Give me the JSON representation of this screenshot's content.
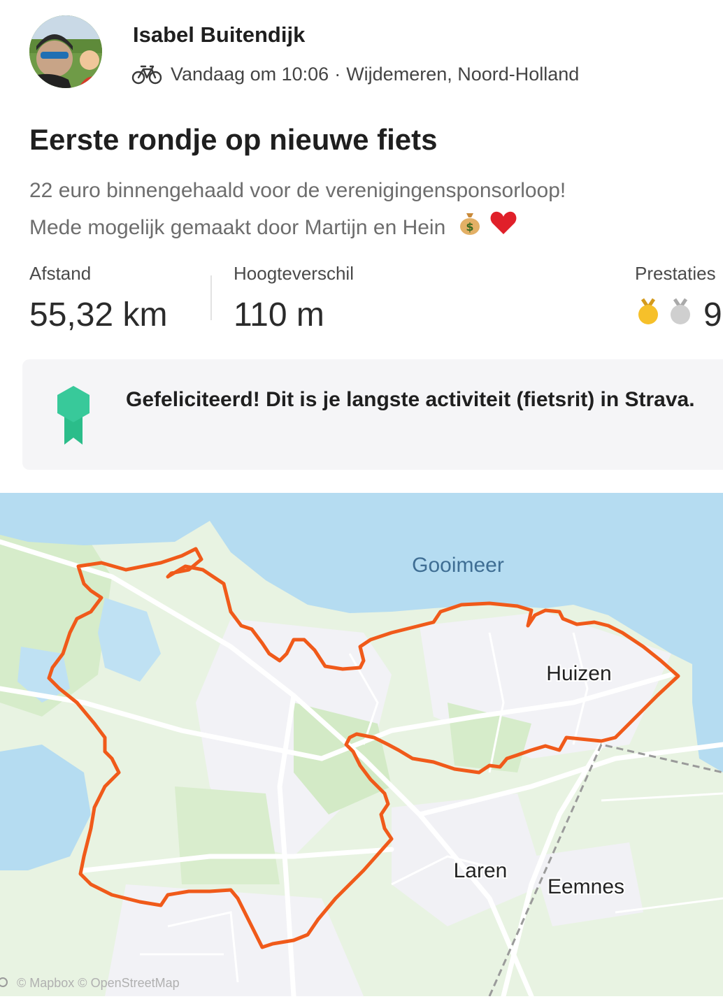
{
  "athlete": {
    "name": "Isabel Buitendijk"
  },
  "activity": {
    "sport_icon": "bike-icon",
    "time": "Vandaag om 10:06",
    "separator": "·",
    "location": "Wijdemeren, Noord-Holland",
    "title": "Eerste rondje op nieuwe fiets",
    "description_line1": "22 euro binnengehaald voor de verenigingensponsorloop!",
    "description_line2": "Mede mogelijk gemaakt door Martijn en Hein",
    "description_emojis": [
      "money-bag-icon",
      "red-heart-icon"
    ]
  },
  "stats": {
    "distance": {
      "label": "Afstand",
      "value": "55,32 km"
    },
    "elevation": {
      "label": "Hoogteverschil",
      "value": "110 m"
    },
    "achievements": {
      "label": "Prestaties",
      "value": "9",
      "icons": [
        "gold-medal-icon",
        "silver-medal-icon"
      ]
    }
  },
  "banner": {
    "icon": "ribbon-badge-icon",
    "text": "Gefeliciteerd! Dit is je langste activiteit (fietsrit) in Strava."
  },
  "map": {
    "labels": {
      "lake": "Gooimeer",
      "town1": "Huizen",
      "town2": "Laren",
      "town3": "Eemnes"
    },
    "attribution": "© Mapbox © OpenStreetMap",
    "colors": {
      "route": "#f05a1a",
      "water": "#b5dcf1",
      "land": "#e9f4e4",
      "urban": "#f3f3f7",
      "park": "#cfe8c3"
    }
  }
}
